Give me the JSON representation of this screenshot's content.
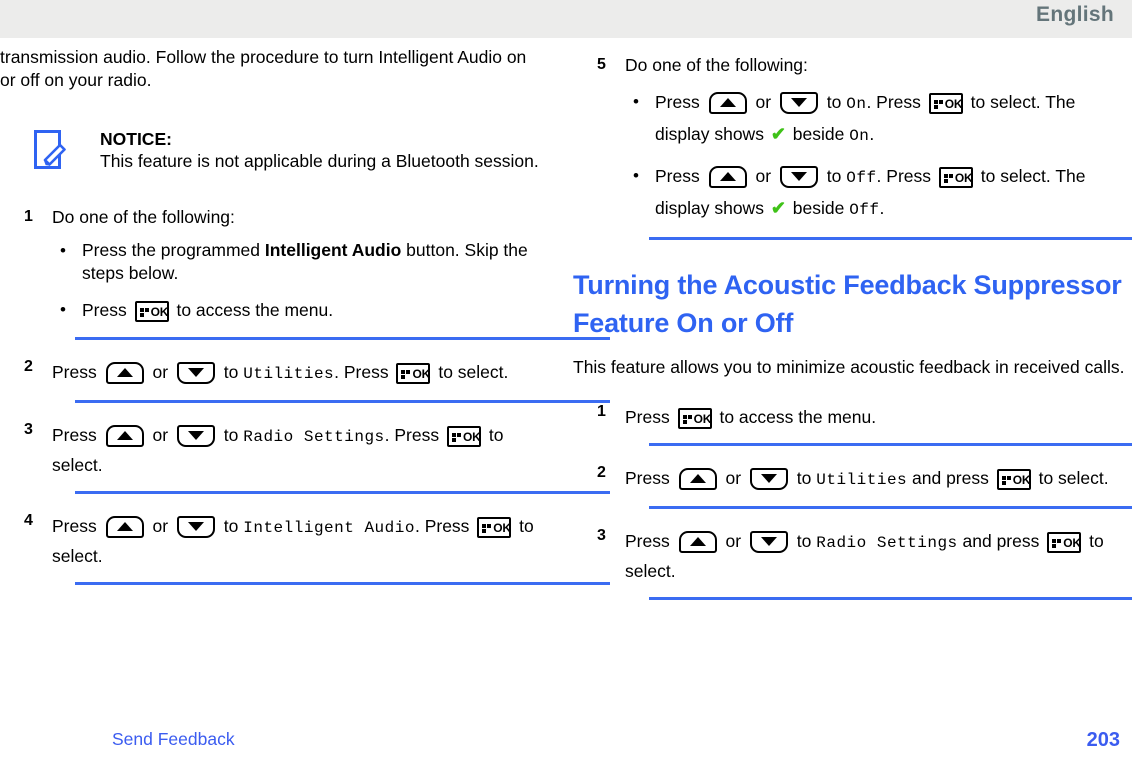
{
  "header": {
    "language": "English"
  },
  "icons": {
    "notice": "notice-pencil-icon",
    "ok_key": "menu-ok-key-icon",
    "up_key": "scroll-up-key-icon",
    "down_key": "scroll-down-key-icon",
    "check": "✔"
  },
  "colors": {
    "heading_blue": "#2f63f2",
    "rule_blue": "#3b6cf2",
    "link_blue": "#3b5cf0",
    "header_band": "#ececeb",
    "header_text": "#64757a",
    "check_green": "#3fc218"
  },
  "left_column": {
    "intro_paragraph": "transmission audio. Follow the procedure to turn Intelligent Audio on or off on your radio.",
    "notice": {
      "title": "NOTICE:",
      "text": "This feature is not applicable during a Bluetooth session."
    },
    "steps": [
      {
        "number": "1",
        "lead": "Do one of the following:",
        "bullets": [
          {
            "pre": "Press the programmed ",
            "bold": "Intelligent Audio",
            "post": " button. Skip the steps below."
          },
          {
            "pre": "Press ",
            "post": " to access the menu."
          }
        ]
      },
      {
        "number": "2",
        "t1": "Press ",
        "t2": " or ",
        "t3": " to ",
        "mono1": "Utilities",
        "t4": ". Press ",
        "t5": " to select."
      },
      {
        "number": "3",
        "t1": "Press ",
        "t2": " or ",
        "t3": " to ",
        "mono1": "Radio Settings",
        "t4": ". Press ",
        "t5": " to select."
      },
      {
        "number": "4",
        "t1": "Press ",
        "t2": " or ",
        "t3": " to ",
        "mono1": "Intelligent Audio",
        "t4": ". Press ",
        "t5": " to select."
      }
    ]
  },
  "right_column": {
    "step5": {
      "number": "5",
      "lead": "Do one of the following:",
      "bullets": [
        {
          "t1": "Press ",
          "t2": " or ",
          "t3": " to ",
          "mono1": "On",
          "t4": ". Press ",
          "t5": " to select. The display shows ",
          "t6": " beside ",
          "mono2": "On",
          "t7": "."
        },
        {
          "t1": "Press ",
          "t2": " or ",
          "t3": " to ",
          "mono1": "Off",
          "t4": ". Press ",
          "t5": " to select. The display shows ",
          "t6": " beside ",
          "mono2": "Off",
          "t7": "."
        }
      ]
    },
    "section": {
      "heading": "Turning the Acoustic Feedback Suppressor Feature On or Off",
      "intro": "This feature allows you to minimize acoustic feedback in received calls."
    },
    "steps": [
      {
        "number": "1",
        "t1": "Press ",
        "t5": " to access the menu."
      },
      {
        "number": "2",
        "t1": "Press ",
        "t2": " or ",
        "t3": " to ",
        "mono1": "Utilities",
        "t4": " and press ",
        "t5": " to select."
      },
      {
        "number": "3",
        "t1": "Press ",
        "t2": " or ",
        "t3": " to ",
        "mono1": "Radio Settings",
        "t4": " and press ",
        "t5": " to select."
      }
    ]
  },
  "footer": {
    "feedback_link": "Send Feedback",
    "page_number": "203"
  }
}
